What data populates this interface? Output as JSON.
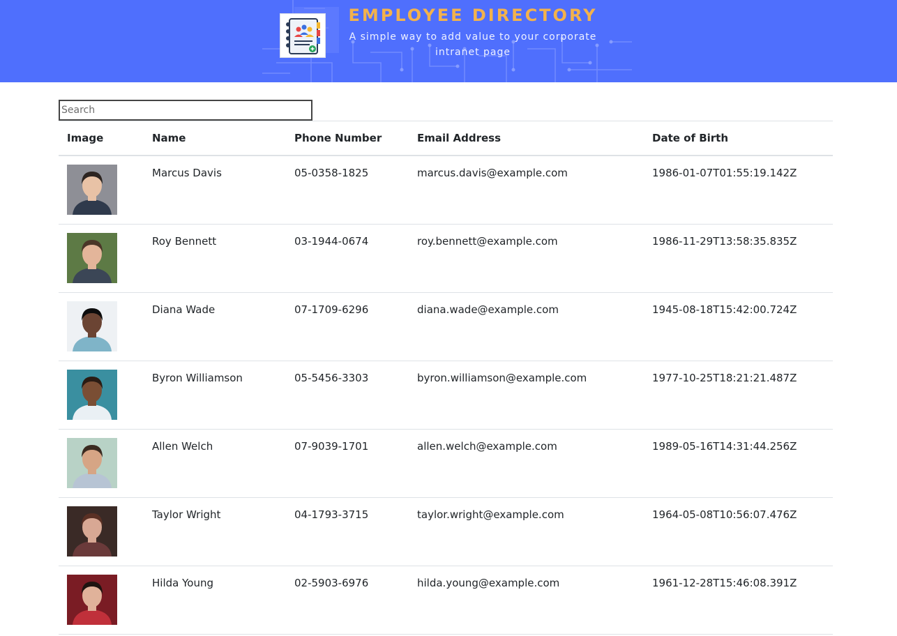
{
  "header": {
    "title": "EMPLOYEE DIRECTORY",
    "subtitle": "A simple way to add value to your corporate intranet page",
    "bg_color": "#4f6ffd",
    "title_color": "#f3b24c",
    "logo_icon": "address-book-icon"
  },
  "search": {
    "placeholder": "Search",
    "value": ""
  },
  "table": {
    "columns": [
      "Image",
      "Name",
      "Phone Number",
      "Email Address",
      "Date of Birth"
    ],
    "rows": [
      {
        "name": "Marcus Davis",
        "phone": "05-0358-1825",
        "email": "marcus.davis@example.com",
        "dob": "1986-01-07T01:55:19.142Z",
        "avatar": {
          "bg": "#8e8f96",
          "skin": "#e8c2a6",
          "hair": "#2c2420",
          "shirt": "#2f3a4c"
        }
      },
      {
        "name": "Roy Bennett",
        "phone": "03-1944-0674",
        "email": "roy.bennett@example.com",
        "dob": "1986-11-29T13:58:35.835Z",
        "avatar": {
          "bg": "#5d7a45",
          "skin": "#e3b59a",
          "hair": "#4a3628",
          "shirt": "#3b4656"
        }
      },
      {
        "name": "Diana Wade",
        "phone": "07-1709-6296",
        "email": "diana.wade@example.com",
        "dob": "1945-08-18T15:42:00.724Z",
        "avatar": {
          "bg": "#eef1f4",
          "skin": "#6b4433",
          "hair": "#0d0d0d",
          "shirt": "#7fb4c8"
        }
      },
      {
        "name": "Byron Williamson",
        "phone": "05-5456-3303",
        "email": "byron.williamson@example.com",
        "dob": "1977-10-25T18:21:21.487Z",
        "avatar": {
          "bg": "#3a8fa0",
          "skin": "#7a4e34",
          "hair": "#2a1c14",
          "shirt": "#eaf0f4"
        }
      },
      {
        "name": "Allen Welch",
        "phone": "07-9039-1701",
        "email": "allen.welch@example.com",
        "dob": "1989-05-16T14:31:44.256Z",
        "avatar": {
          "bg": "#b8d2c6",
          "skin": "#d6a585",
          "hair": "#3a2a20",
          "shirt": "#b7c4d4"
        }
      },
      {
        "name": "Taylor Wright",
        "phone": "04-1793-3715",
        "email": "taylor.wright@example.com",
        "dob": "1964-05-08T10:56:07.476Z",
        "avatar": {
          "bg": "#3a2a26",
          "skin": "#d8a894",
          "hair": "#5a3024",
          "shirt": "#6a3a3a"
        }
      },
      {
        "name": "Hilda Young",
        "phone": "02-5903-6976",
        "email": "hilda.young@example.com",
        "dob": "1961-12-28T15:46:08.391Z",
        "avatar": {
          "bg": "#7a1c24",
          "skin": "#e0b29a",
          "hair": "#1e1410",
          "shirt": "#c0303a"
        }
      }
    ]
  }
}
